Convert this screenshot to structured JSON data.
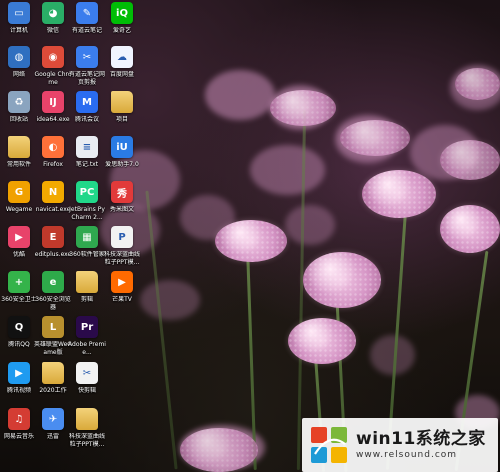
{
  "desktop": {
    "icons": [
      {
        "label": "计算机",
        "icon": "computer-icon",
        "color": "#3a7bd5"
      },
      {
        "label": "网络",
        "icon": "network-icon",
        "color": "#2f6fc0"
      },
      {
        "label": "回收站",
        "icon": "recycle-bin-icon",
        "color": "#8aa4bf"
      },
      {
        "label": "常用软件",
        "icon": "folder-icon",
        "color": "#e0b84a"
      },
      {
        "label": "Wegame",
        "icon": "wegame-icon",
        "color": "#f0a100"
      },
      {
        "label": "优酷",
        "icon": "youku-icon",
        "color": "#e8436a"
      },
      {
        "label": "360安全卫士",
        "icon": "360-safe-icon",
        "color": "#34b34a"
      },
      {
        "label": "腾讯QQ",
        "icon": "qq-icon",
        "color": "#111111"
      },
      {
        "label": "腾讯视频",
        "icon": "tencent-video-icon",
        "color": "#1f9bf0"
      },
      {
        "label": "网易云音乐",
        "icon": "netease-music-icon",
        "color": "#d43c33"
      },
      {
        "label": "微信",
        "icon": "wechat-icon",
        "color": "#2aae67"
      },
      {
        "label": "Google Chrome",
        "icon": "chrome-icon",
        "color": "#dd4b39"
      },
      {
        "label": "idea64.exe",
        "icon": "intellij-icon",
        "color": "#e8436a"
      },
      {
        "label": "Firefox",
        "icon": "firefox-icon",
        "color": "#ff7139"
      },
      {
        "label": "navicat.exe",
        "icon": "navicat-icon",
        "color": "#f2a900"
      },
      {
        "label": "editplus.exe",
        "icon": "editplus-icon",
        "color": "#c0392b"
      },
      {
        "label": "360安全浏览器",
        "icon": "360-browser-icon",
        "color": "#2eaa4a"
      },
      {
        "label": "英雄联盟WeGame版",
        "icon": "lol-icon",
        "color": "#b8902e"
      },
      {
        "label": "2020工作",
        "icon": "folder-icon",
        "color": "#e0b84a"
      },
      {
        "label": "迅雷",
        "icon": "xunlei-icon",
        "color": "#4a8df0"
      },
      {
        "label": "有道云笔记",
        "icon": "youdao-note-icon",
        "color": "#3b7ded"
      },
      {
        "label": "有道云笔记网页剪报",
        "icon": "web-clipper-icon",
        "color": "#3b7ded"
      },
      {
        "label": "腾讯会议",
        "icon": "tencent-meeting-icon",
        "color": "#2a6cf0"
      },
      {
        "label": "笔记.txt",
        "icon": "text-file-icon",
        "color": "#e9ecf2"
      },
      {
        "label": "JetBrains PyCharm 2...",
        "icon": "pycharm-icon",
        "color": "#21d789"
      },
      {
        "label": "360软件管家",
        "icon": "360-software-icon",
        "color": "#2fa84f"
      },
      {
        "label": "剪辑",
        "icon": "folder-icon",
        "color": "#e0b84a"
      },
      {
        "label": "Adobe Premie...",
        "icon": "premiere-icon",
        "color": "#2a0a4a"
      },
      {
        "label": "快剪辑",
        "icon": "kuaijianji-icon",
        "color": "#f2f2f2"
      },
      {
        "label": "科技深蓝曲线粒子PPT模...",
        "icon": "folder-icon",
        "color": "#e0b84a"
      },
      {
        "label": "爱奇艺",
        "icon": "iqiyi-icon",
        "color": "#00be06"
      },
      {
        "label": "百度网盘",
        "icon": "baidu-netdisk-icon",
        "color": "#f0f4ff"
      },
      {
        "label": "项目",
        "icon": "folder-icon",
        "color": "#e0b84a"
      },
      {
        "label": "爱思助手7.0",
        "icon": "aisi-icon",
        "color": "#2a7be4"
      },
      {
        "label": "秀米图文",
        "icon": "xiumi-icon",
        "color": "#e23a3a"
      },
      {
        "label": "科技深蓝曲线粒子PPT模...",
        "icon": "ppt-file-icon",
        "color": "#f2f2f2"
      },
      {
        "label": "芒果TV",
        "icon": "mango-tv-icon",
        "color": "#ff6a00"
      }
    ]
  },
  "watermark": {
    "title": "win11系统之家",
    "url": "www.relsound.com",
    "logo": "windows-logo-icon"
  }
}
